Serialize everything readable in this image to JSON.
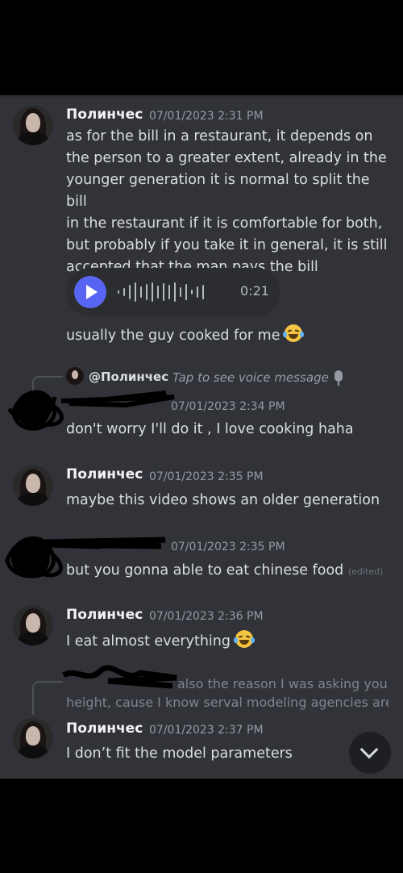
{
  "messages": {
    "m1": {
      "author": "Полинчес",
      "timestamp": "07/01/2023 2:31 PM",
      "lines": [
        "as for the bill in a restaurant, it depends on",
        "the person to a greater extent, already in the",
        "younger generation it is normal to split the bill",
        "in the restaurant if it is comfortable for both,",
        "but probably if you take it in general, it is still",
        "accepted that the man pays the bill"
      ],
      "voice_duration": "0:21",
      "followup": "usually the guy cooked for me"
    },
    "m2": {
      "reply_to": "@Полинчес",
      "reply_preview": "Tap to see voice message",
      "timestamp": "07/01/2023 2:34 PM",
      "text": "don't worry I'll do it , I love cooking haha"
    },
    "m3": {
      "author": "Полинчес",
      "timestamp": "07/01/2023 2:35 PM",
      "text": "maybe this video shows an older generation"
    },
    "m4": {
      "timestamp": "07/01/2023 2:35 PM",
      "text": "but you gonna able to eat chinese food",
      "edited": "(edited)"
    },
    "m5": {
      "author": "Полинчес",
      "timestamp": "07/01/2023 2:36 PM",
      "text": "I eat almost everything"
    },
    "m6": {
      "reply_quote_1": "also the reason I was asking your",
      "reply_quote_2": "height, cause I know serval modeling agencies are ...",
      "author": "Полинчес",
      "timestamp": "07/01/2023 2:37 PM",
      "text": "I don’t  fit the model parameters"
    }
  },
  "icons": {
    "play": "play-icon",
    "mic": "microphone-icon",
    "scroll": "chevron-down-icon",
    "emoji": "tears-of-joy-emoji"
  },
  "colors": {
    "chat_bg": "#313338",
    "accent": "#5865f2",
    "muted": "#949ba4"
  }
}
